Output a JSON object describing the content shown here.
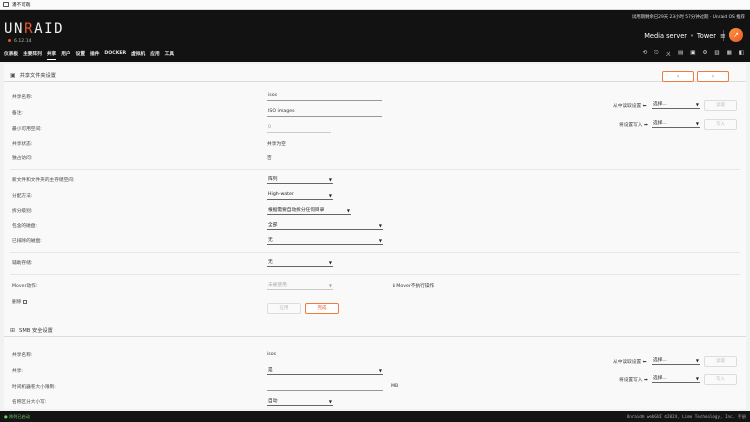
{
  "window": {
    "title": "潘不可踹"
  },
  "header": {
    "logo_prefix": "UN",
    "logo_red": "R",
    "logo_suffix": "AID",
    "version": "6.12.14",
    "trial_text": "试用期剩余已29天 23小时 57分钟过期",
    "trial_sep": "·",
    "os_text": "Unraid OS 推荐",
    "server_name": "Media server",
    "server_sep": "•",
    "server_host": "Tower",
    "menu_icon": "≡",
    "orb_icon": "↗"
  },
  "nav": {
    "items": [
      "仪表板",
      "主要阵列",
      "共享",
      "用户",
      "设置",
      "插件",
      "DOCKER",
      "虚拟机",
      "应用",
      "工具"
    ],
    "active_index": 2,
    "tool_icons": [
      "⟲",
      "⎋",
      "ㄨ",
      "▤",
      "▣",
      "⚙",
      "▥",
      "▦",
      "◧"
    ]
  },
  "share_section": {
    "title": "共享文件夹设置",
    "prev": "‹",
    "next": "›",
    "fields": {
      "name_label": "共享名称:",
      "name_value": "isos",
      "comment_label": "备注:",
      "comment_value": "ISO images",
      "min_free_label": "最小可用空间:",
      "min_free_placeholder": "0",
      "status_label": "共享状态:",
      "status_value": "共享为空",
      "exclusive_label": "独占访问:",
      "exclusive_value": "否",
      "primary_storage_label": "新文件和文件夹的主存储空间:",
      "primary_storage_value": "阵列",
      "alloc_label": "分配方法:",
      "alloc_value": "High-water",
      "split_label": "拆分级别:",
      "split_value": "根据需要自动拆分任何目录",
      "included_label": "包含的磁盘:",
      "included_value": "全部",
      "excluded_label": "已排除的磁盘:",
      "excluded_value": "无",
      "secondary_label": "辅助存储:",
      "secondary_value": "无",
      "mover_label": "Mover动作:",
      "mover_value": "未被使用",
      "mover_note": "Mover不执行操作",
      "delete_label": "删除"
    },
    "buttons": {
      "apply": "应用",
      "done": "完成"
    },
    "side": {
      "read_label": "从中读取设置",
      "read_select": "选择...",
      "read_btn": "读取",
      "write_label": "将设置写入",
      "write_select": "选择...",
      "write_btn": "写入"
    }
  },
  "smb_section": {
    "title": "SMB 安全设置",
    "fields": {
      "name_label": "共享名称:",
      "name_value": "isos",
      "share_label": "共享:",
      "share_value": "是",
      "tm_label": "时间机器卷大小限制:",
      "tm_unit": "MB",
      "case_label": "名称区分大小写:",
      "case_value": "自动"
    },
    "side": {
      "read_label": "从中读取设置",
      "read_select": "选择...",
      "read_btn": "读取",
      "write_label": "将设置写入",
      "write_select": "选择...",
      "write_btn": "写入"
    }
  },
  "footer": {
    "status": "● 阵列已启动",
    "copyright": "Unraid® webGUI ©2024, Lime Technology, Inc. 手册"
  },
  "colors": {
    "accent": "#e8562a",
    "header_bg": "#121212",
    "ok": "#6ed06e"
  }
}
